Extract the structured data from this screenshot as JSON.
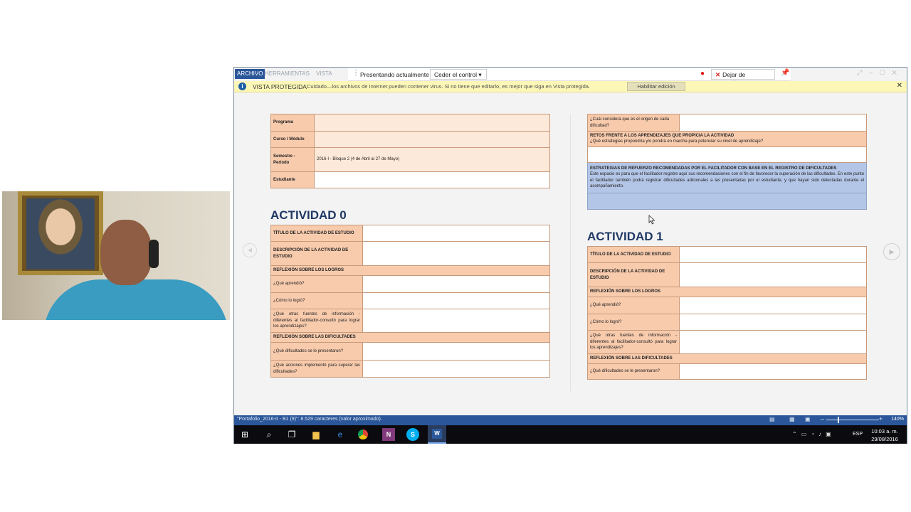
{
  "ribbon": {
    "tabs": [
      "ARCHIVO",
      "HERRAMIENTAS",
      "VISTA"
    ]
  },
  "present_bar": {
    "presenting_label": "Presentando actualmente",
    "control_button": "Ceder el control",
    "stop_button": "Dejar de presentar"
  },
  "protected_view": {
    "title": "VISTA PROTEGIDA",
    "message": "Cuidado—los archivos de Internet pueden contener virus. Si no tiene que editarlo, es mejor que siga en Vista protegida.",
    "enable_button": "Habilitar edición"
  },
  "left_page": {
    "info_table": [
      {
        "label": "Programa",
        "value": ""
      },
      {
        "label": "Curso / Módulo",
        "value": ""
      },
      {
        "label": "Semestre - Período",
        "value": "2016-I - Bloque 2 (4 de Abril al 27 de Mayo)"
      },
      {
        "label": "Estudiante",
        "value": ""
      }
    ],
    "heading": "ACTIVIDAD 0",
    "activity_rows": {
      "titulo": "TÍTULO DE LA ACTIVIDAD DE ESTUDIO",
      "descripcion": "DESCRIPCIÓN DE LA ACTIVIDAD DE ESTUDIO",
      "reflexion_logros": "REFLEXIÓN SOBRE LOS LOGROS",
      "que_aprendio": "¿Qué aprendió?",
      "como_logro": "¿Cómo lo logró?",
      "fuentes": "¿Qué otras fuentes de información - diferentes al facilitador-consultó para lograr los aprendizajes?",
      "reflexion_dificultades": "REFLEXIÓN SOBRE LAS DIFICULTADES",
      "que_dificultades": "¿Qué dificultades se le presentaron?",
      "que_acciones": "¿Qué acciones implementó para superar las dificultades?"
    }
  },
  "right_page": {
    "top_table": {
      "origen": "¿Cuál considera que es el origen de cada dificultad?",
      "retos_title": "RETOS FRENTE A LOS APRENDIZAJES QUE PROPICIA LA ACTIVIDAD",
      "retos_question": "¿Qué estrategias propondría y/o pondrá en marcha para potenciar su nivel de aprendizaje?",
      "estrategias_title": "ESTRATEGIAS DE REFUERZO RECOMENDADAS POR EL FACILITADOR CON BASE EN EL REGISTRO DE DIFICULTADES",
      "estrategias_text": "Este espacio es para que el facilitador registre aquí sus recomendaciones con el fin de favorecer la superación de las dificultades. En este punto el facilitador también podrá registrar dificultades adicionales a las presentadas por el estudiante, y que hayan sido detectadas durante el acompañamiento."
    },
    "heading": "ACTIVIDAD 1",
    "activity_rows": {
      "titulo": "TÍTULO DE LA ACTIVIDAD DE ESTUDIO",
      "descripcion": "DESCRIPCIÓN DE LA ACTIVIDAD DE ESTUDIO",
      "reflexion_logros": "REFLEXIÓN SOBRE LOS LOGROS",
      "que_aprendio": "¿Qué aprendió?",
      "como_logro": "¿Cómo lo logró?",
      "fuentes": "¿Qué otras fuentes de información - diferentes al facilitador-consultó para lograr los aprendizajes?",
      "reflexion_dificultades": "REFLEXIÓN SOBRE LAS DIFICULTADES",
      "que_dificultades": "¿Qué dificultades se le presentaron?"
    }
  },
  "status_bar": {
    "text": "\"Portafolio_2016-II - B1 (9)\": 8.529 caracteres (valor aproximado).",
    "zoom": "140%"
  },
  "taskbar": {
    "language": "ESP",
    "time": "10:03 a. m.",
    "date": "29/08/2016"
  },
  "colors": {
    "word_blue": "#2b579a",
    "table_orange": "#f8cbad",
    "table_blue": "#b4c6e7",
    "heading_navy": "#1f3864",
    "protected_yellow": "#fcf7b6"
  }
}
